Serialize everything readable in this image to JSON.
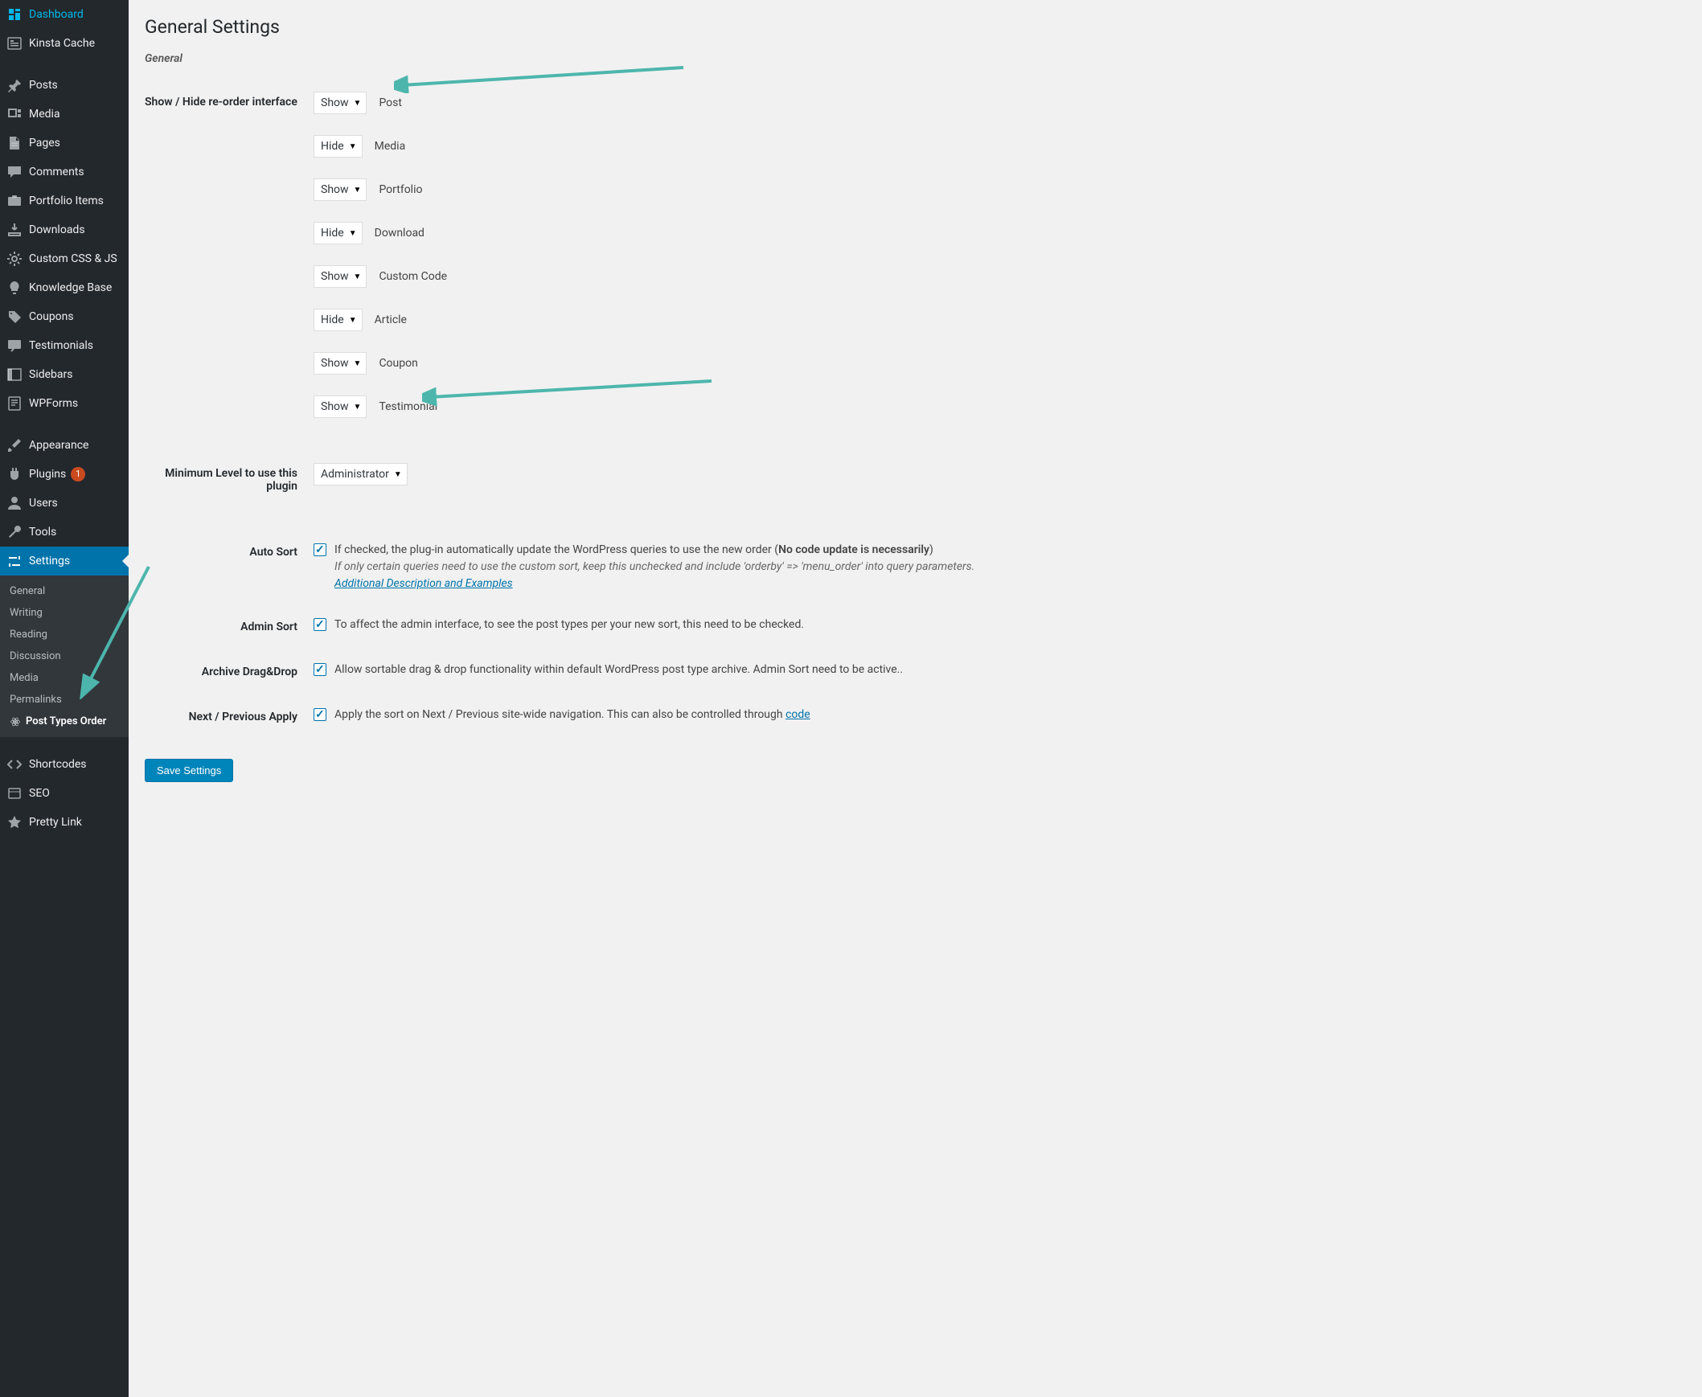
{
  "sidebar": {
    "items": [
      {
        "label": "Dashboard",
        "icon": "dashboard"
      },
      {
        "label": "Kinsta Cache",
        "icon": "kinsta"
      },
      {
        "label": "Posts",
        "icon": "pin"
      },
      {
        "label": "Media",
        "icon": "media"
      },
      {
        "label": "Pages",
        "icon": "page"
      },
      {
        "label": "Comments",
        "icon": "comment"
      },
      {
        "label": "Portfolio Items",
        "icon": "portfolio"
      },
      {
        "label": "Downloads",
        "icon": "download"
      },
      {
        "label": "Custom CSS & JS",
        "icon": "gear"
      },
      {
        "label": "Knowledge Base",
        "icon": "bulb"
      },
      {
        "label": "Coupons",
        "icon": "tag"
      },
      {
        "label": "Testimonials",
        "icon": "testimonial"
      },
      {
        "label": "Sidebars",
        "icon": "sidebar"
      },
      {
        "label": "WPForms",
        "icon": "wpforms"
      },
      {
        "label": "Appearance",
        "icon": "brush"
      },
      {
        "label": "Plugins",
        "icon": "plugin",
        "badge": "1"
      },
      {
        "label": "Users",
        "icon": "user"
      },
      {
        "label": "Tools",
        "icon": "wrench"
      },
      {
        "label": "Settings",
        "icon": "settings",
        "active": true
      },
      {
        "label": "Shortcodes",
        "icon": "code"
      },
      {
        "label": "SEO",
        "icon": "seo"
      },
      {
        "label": "Pretty Link",
        "icon": "star"
      }
    ],
    "submenu": [
      {
        "label": "General"
      },
      {
        "label": "Writing"
      },
      {
        "label": "Reading"
      },
      {
        "label": "Discussion"
      },
      {
        "label": "Media"
      },
      {
        "label": "Permalinks"
      },
      {
        "label": "Post Types Order",
        "current": true
      }
    ]
  },
  "page": {
    "title": "General Settings",
    "section": "General"
  },
  "interface_label": "Show / Hide re-order interface",
  "post_types": [
    {
      "select": "Show",
      "label": "Post"
    },
    {
      "select": "Hide",
      "label": "Media"
    },
    {
      "select": "Show",
      "label": "Portfolio"
    },
    {
      "select": "Hide",
      "label": "Download"
    },
    {
      "select": "Show",
      "label": "Custom Code"
    },
    {
      "select": "Hide",
      "label": "Article"
    },
    {
      "select": "Show",
      "label": "Coupon"
    },
    {
      "select": "Show",
      "label": "Testimonial"
    }
  ],
  "min_level": {
    "label": "Minimum Level to use this plugin",
    "value": "Administrator"
  },
  "checks": {
    "auto_sort": {
      "label": "Auto Sort",
      "text_pre": "If checked, the plug-in automatically update the WordPress queries to use the new order (",
      "text_bold": "No code update is necessarily",
      "text_post": ")",
      "note": "If only certain queries need to use the custom sort, keep this unchecked and include 'orderby' => 'menu_order' into query parameters.",
      "link": "Additional Description and Examples"
    },
    "admin_sort": {
      "label": "Admin Sort",
      "text": "To affect the admin interface, to see the post types per your new sort, this need to be checked."
    },
    "archive": {
      "label": "Archive Drag&Drop",
      "text": "Allow sortable drag & drop functionality within default WordPress post type archive. Admin Sort need to be active.."
    },
    "nextprev": {
      "label": "Next / Previous Apply",
      "text": "Apply the sort on Next / Previous site-wide navigation. This can also be controlled through ",
      "link": "code"
    }
  },
  "save_label": "Save Settings"
}
